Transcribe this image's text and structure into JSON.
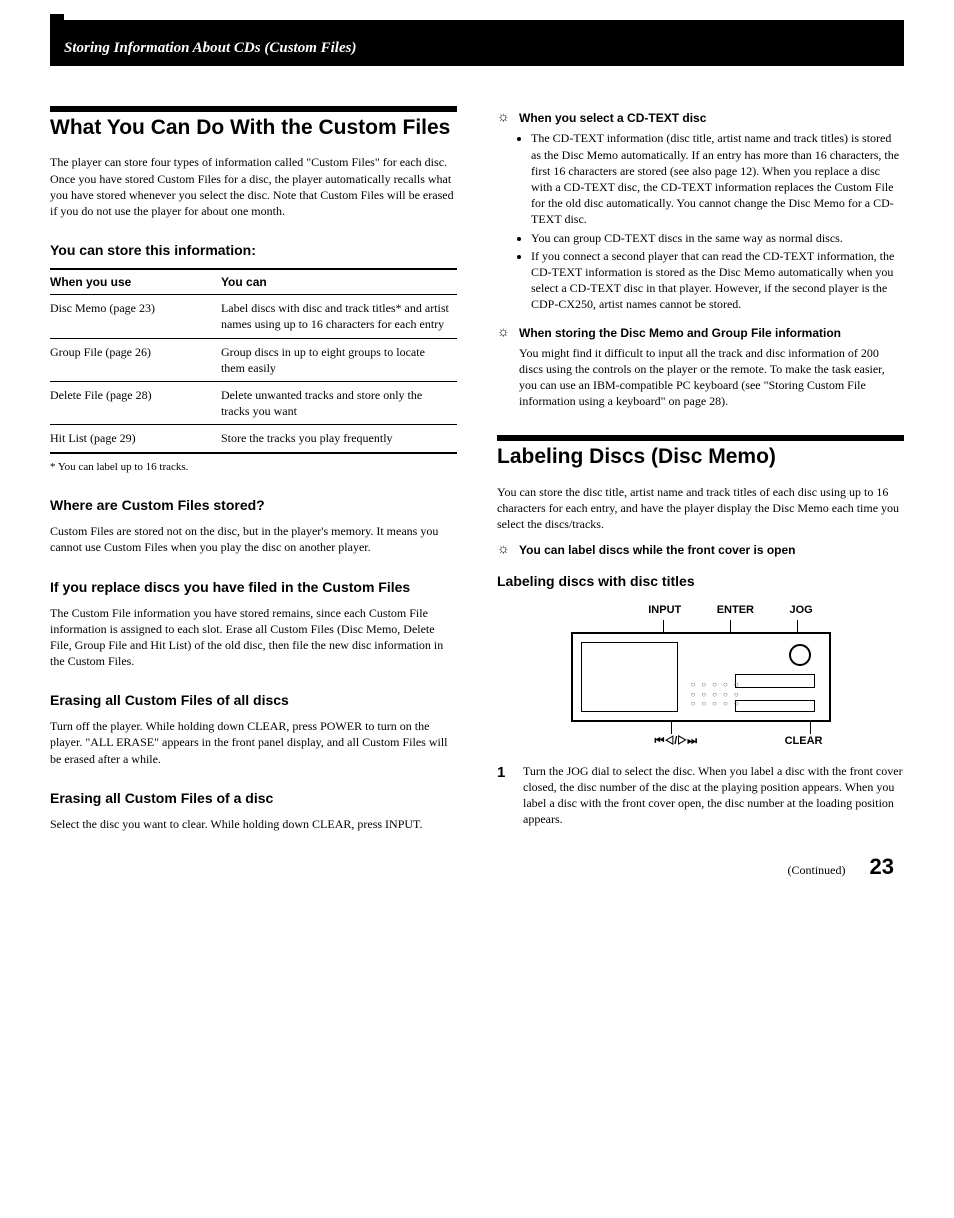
{
  "header": "Storing Information About CDs (Custom Files)",
  "left": {
    "title": "What You Can Do With the Custom Files",
    "intro": "The player can store four types of information called \"Custom Files\" for each disc. Once you have stored Custom Files for a disc, the player automatically recalls what you have stored whenever you select the disc. Note that Custom Files will be erased if you do not use the player for about one month.",
    "store_heading": "You can store this information:",
    "table": {
      "h1": "When you use",
      "h2": "You can",
      "rows": [
        {
          "a": "Disc Memo (page 23)",
          "b": "Label discs with disc and track titles* and artist names using up to 16 characters for each entry"
        },
        {
          "a": "Group File (page 26)",
          "b": "Group discs in up to eight groups to locate them easily"
        },
        {
          "a": "Delete File (page 28)",
          "b": "Delete unwanted tracks and store only the tracks you want"
        },
        {
          "a": "Hit List (page 29)",
          "b": "Store the tracks you play frequently"
        }
      ]
    },
    "footnote": "*  You can label up to 16 tracks.",
    "where_h": "Where are Custom Files stored?",
    "where_p": "Custom Files are stored not on the disc, but in the player's memory. It means you cannot use Custom Files when you play the disc on another player.",
    "replace_h": "If you replace discs you have filed in the Custom Files",
    "replace_p": "The Custom File information you have stored remains, since each Custom File information is assigned to each slot. Erase all Custom Files (Disc Memo, Delete File, Group File and Hit List) of the old disc, then file the new disc information in the Custom Files.",
    "erase_all_h": "Erasing all Custom Files of all discs",
    "erase_all_p": "Turn off the player. While holding down CLEAR, press POWER to turn on the player. \"ALL ERASE\" appears in the front panel display, and all Custom Files will be erased after a while.",
    "erase_one_h": "Erasing all Custom Files of a disc",
    "erase_one_p": "Select the disc you want to clear. While holding down CLEAR, press INPUT."
  },
  "right": {
    "tip1_title": "When you select a CD-TEXT disc",
    "tip1_bullets": [
      "The CD-TEXT information (disc title, artist name and track titles) is stored as the Disc Memo automatically. If an entry has more than 16 characters, the first 16 characters are stored (see also page 12). When you replace a disc with a CD-TEXT disc, the CD-TEXT information replaces the Custom File for the old disc automatically. You cannot change the Disc Memo for a CD-TEXT disc.",
      "You can group CD-TEXT discs in the same way as normal discs.",
      "If you connect a second player that can read the CD-TEXT information, the CD-TEXT information is stored as the Disc Memo automatically when you select a CD-TEXT disc in that player. However, if the second player is the CDP-CX250, artist names cannot be stored."
    ],
    "tip2_title": "When storing the Disc Memo and Group File information",
    "tip2_body": "You might find it difficult to input all the track and disc information of 200 discs using the controls on the player or the remote. To make the task easier, you can use an IBM-compatible PC keyboard (see \"Storing Custom File information using a keyboard\" on page 28).",
    "labeling_title": "Labeling Discs (Disc Memo)",
    "labeling_intro": "You can store the disc title, artist name and track titles of each disc using up to 16 characters for each entry, and have the player display the Disc Memo each time you select the discs/tracks.",
    "tip3_title": "You can label discs while the front cover is open",
    "sub_h": "Labeling discs with disc titles",
    "diagram": {
      "top": [
        "INPUT",
        "ENTER",
        "JOG"
      ],
      "bottom_left": "⏮◁/▷⏭",
      "bottom_right": "CLEAR"
    },
    "step1": "Turn the JOG dial to select the disc. When you label a disc with the front cover closed, the disc number of the disc at the playing position appears. When you label a disc with the front cover open, the disc number at the loading position appears."
  },
  "footer": {
    "continued": "(Continued)",
    "page": "23"
  }
}
